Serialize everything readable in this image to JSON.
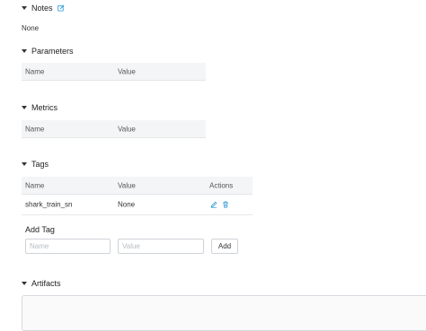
{
  "notes": {
    "title": "Notes",
    "value": "None"
  },
  "parameters": {
    "title": "Parameters",
    "columns": [
      "Name",
      "Value"
    ]
  },
  "metrics": {
    "title": "Metrics",
    "columns": [
      "Name",
      "Value"
    ]
  },
  "tags": {
    "title": "Tags",
    "columns": [
      "Name",
      "Value",
      "Actions"
    ],
    "rows": [
      {
        "name": "shark_train_sn",
        "value": "None"
      }
    ],
    "add_tag": {
      "title": "Add Tag",
      "name_placeholder": "Name",
      "value_placeholder": "Value",
      "add_label": "Add"
    }
  },
  "artifacts": {
    "title": "Artifacts"
  },
  "colors": {
    "accent": "#1a8fd6"
  }
}
